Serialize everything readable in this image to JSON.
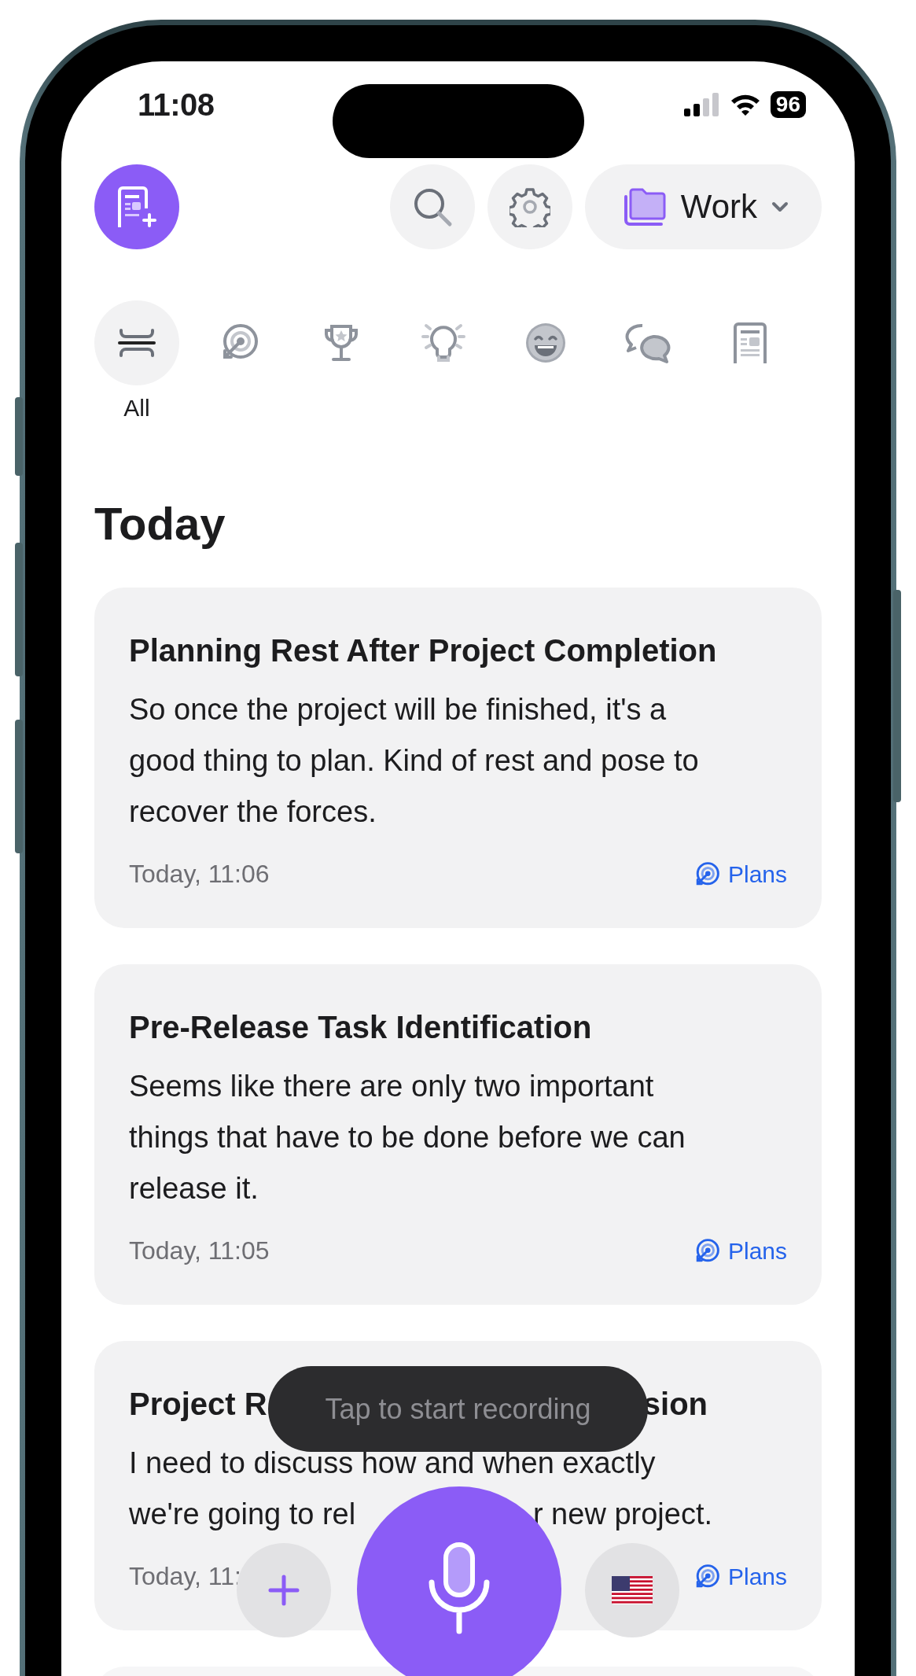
{
  "status_bar": {
    "time": "11:08",
    "battery": "96"
  },
  "header": {
    "folder": "Work"
  },
  "categories": [
    {
      "kind": "all",
      "label": "All",
      "selected": true
    },
    {
      "kind": "target",
      "selected": false
    },
    {
      "kind": "trophy",
      "selected": false
    },
    {
      "kind": "bulb",
      "selected": false
    },
    {
      "kind": "smile",
      "selected": false
    },
    {
      "kind": "chat",
      "selected": false
    },
    {
      "kind": "document",
      "selected": false
    }
  ],
  "section_title": "Today",
  "notes": [
    {
      "title": [
        "Planning Rest After Project Completion"
      ],
      "body": "So once the project will be finished, it's a good thing to plan. Kind of rest and pose to recover the forces.",
      "time": "Today, 11:06",
      "tag": "Plans"
    },
    {
      "title": [
        "Pre-Release Task Identification"
      ],
      "body": "Seems like there are only two important things that have to be done before we can release it.",
      "time": "Today, 11:05",
      "tag": "Plans"
    },
    {
      "title": [
        "Project R",
        "sion"
      ],
      "body": [
        [
          "I need to discuss how and when exactly"
        ],
        [
          "we're going to rel",
          "r new project."
        ]
      ],
      "time": "Today, 11:",
      "tag": "Plans"
    }
  ],
  "toast": "Tap to start recording"
}
